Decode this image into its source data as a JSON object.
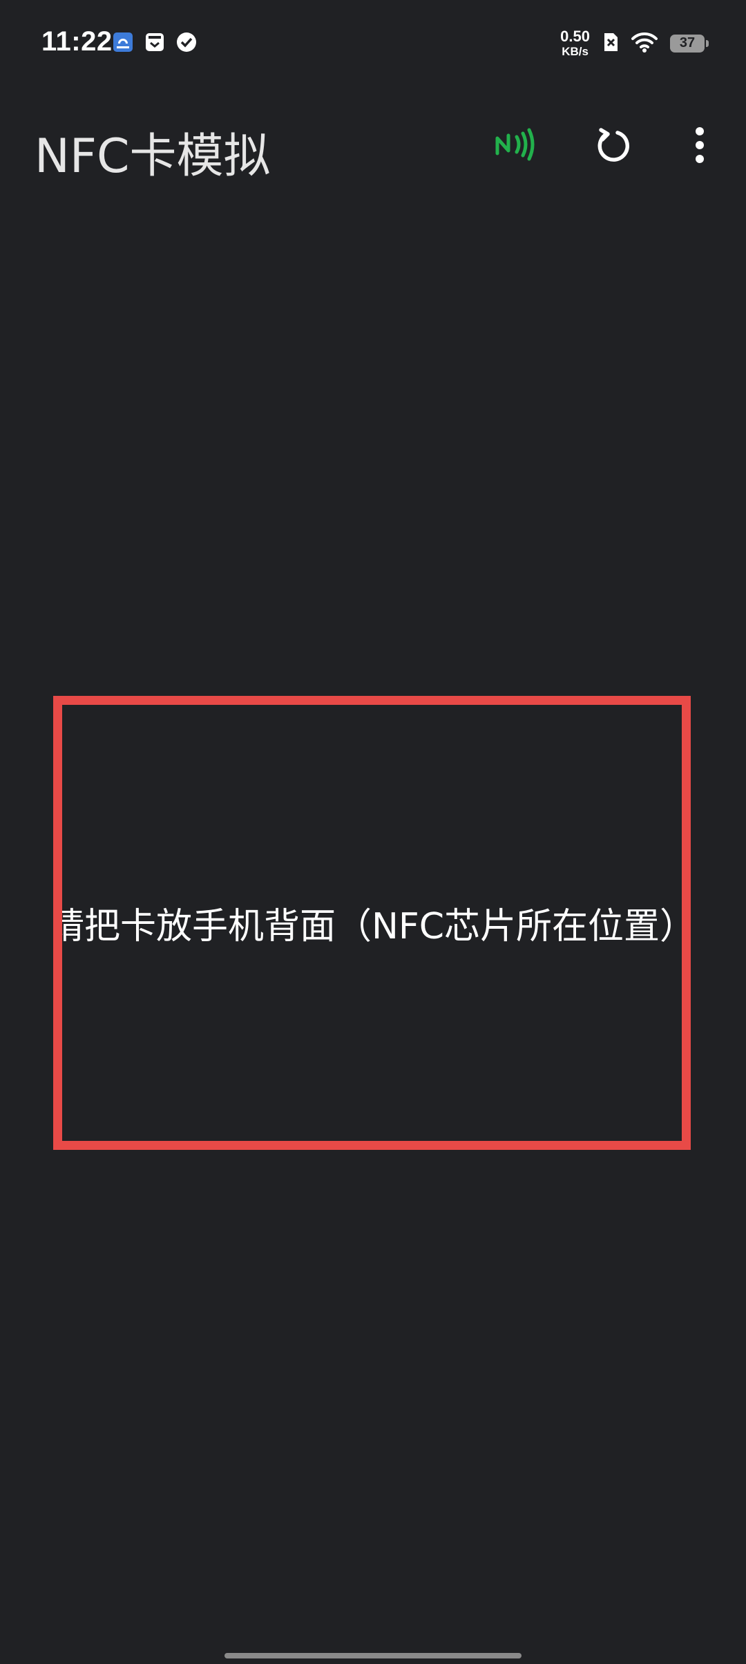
{
  "status_bar": {
    "time": "11:22",
    "notification_icons": [
      "app-notification-icon",
      "calendar-check-icon",
      "checkmark-circle-icon"
    ],
    "net_speed_value": "0.50",
    "net_speed_unit": "KB/s",
    "battery_level": "37"
  },
  "app_bar": {
    "title": "NFC卡模拟",
    "actions": [
      "nfc-icon",
      "refresh-icon",
      "more-vert-icon"
    ]
  },
  "main": {
    "card_prompt": "请把卡放手机背面（NFC芯片所在位置）"
  },
  "colors": {
    "background": "#202124",
    "frame": "#e84a47",
    "nfc_active": "#22b14c"
  }
}
